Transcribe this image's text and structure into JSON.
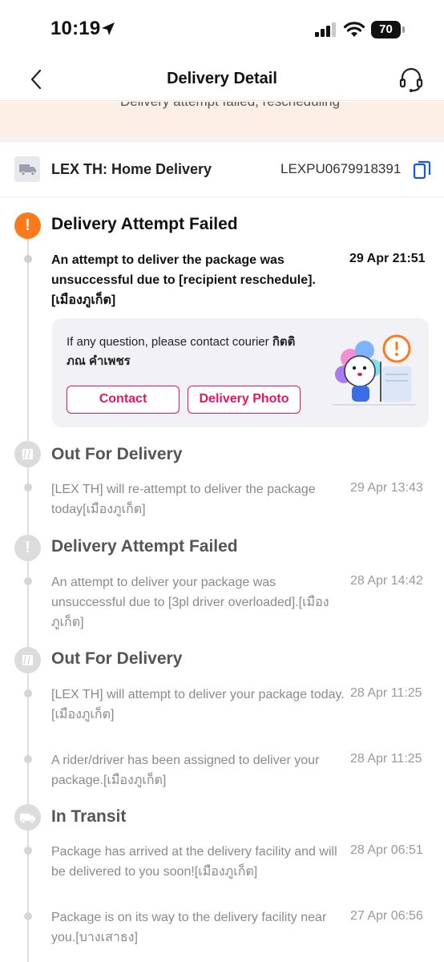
{
  "status_bar": {
    "time": "10:19",
    "battery": "70"
  },
  "header": {
    "title": "Delivery Detail"
  },
  "notice": {
    "text": "Delivery attempt failed, rescheduling"
  },
  "courier": {
    "name": "LEX TH: Home Delivery",
    "tracking_number": "LEXPU0679918391"
  },
  "events": [
    {
      "status": "Delivery Attempt Failed",
      "updates": [
        {
          "text": "An attempt to deliver the package was unsuccessful due to [recipient reschedule].[เมืองภูเก็ต]",
          "time": "29 Apr 21:51"
        }
      ]
    },
    {
      "status": "Out For Delivery",
      "updates": [
        {
          "text": "[LEX TH] will re-attempt to deliver the package today[เมืองภูเก็ต]",
          "time": "29 Apr 13:43"
        }
      ]
    },
    {
      "status": "Delivery Attempt Failed",
      "updates": [
        {
          "text": "An attempt to deliver your package was unsuccessful due to [3pl driver overloaded].[เมืองภูเก็ต]",
          "time": "28 Apr 14:42"
        }
      ]
    },
    {
      "status": "Out For Delivery",
      "updates": [
        {
          "text": "[LEX TH] will attempt to deliver your package today.[เมืองภูเก็ต]",
          "time": "28 Apr 11:25"
        },
        {
          "text": "A rider/driver has been assigned to deliver your package.[เมืองภูเก็ต]",
          "time": "28 Apr 11:25"
        }
      ]
    },
    {
      "status": "In Transit",
      "updates": [
        {
          "text": "Package has arrived at the delivery facility and will be delivered to you soon![เมืองภูเก็ต]",
          "time": "28 Apr 06:51"
        },
        {
          "text": "Package is on its way to the delivery facility near you.[บางเสาธง]",
          "time": "27 Apr 06:56"
        }
      ]
    }
  ],
  "contact_card": {
    "prompt": "If any question, please contact courier ",
    "courier_name": "กิตติภณ คำเพชร",
    "contact_label": "Contact",
    "photo_label": "Delivery Photo"
  },
  "colors": {
    "accent": "#e0195a",
    "alert": "#fc7a1c",
    "copy_icon": "#1a56db"
  }
}
